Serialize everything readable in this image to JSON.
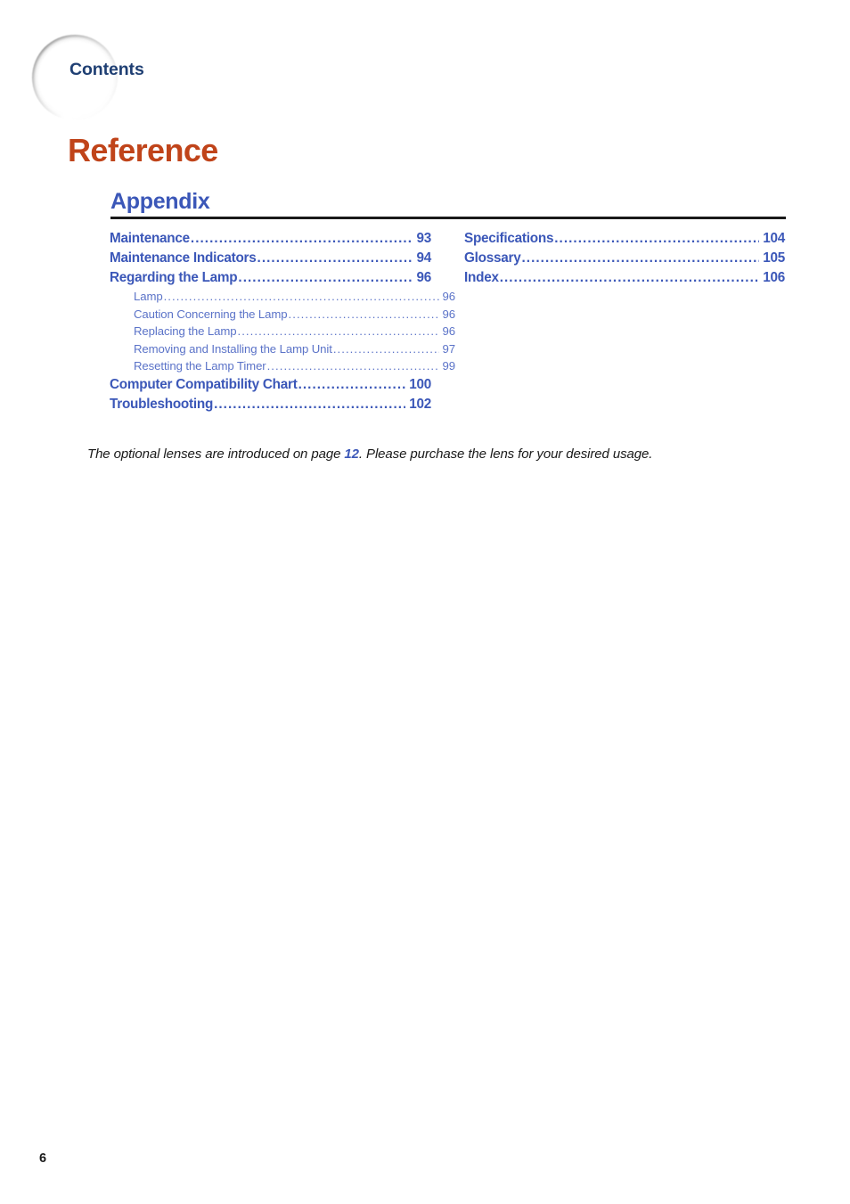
{
  "page": {
    "running_head": "Contents",
    "section_title": "Reference",
    "chapter_title": "Appendix",
    "folio": "6"
  },
  "toc": {
    "left_column": [
      {
        "level": "main",
        "label": "Maintenance",
        "page": "93"
      },
      {
        "level": "main",
        "label": "Maintenance Indicators",
        "page": "94"
      },
      {
        "level": "main",
        "label": "Regarding the Lamp",
        "page": "96"
      },
      {
        "level": "sub",
        "label": "Lamp",
        "page": "96"
      },
      {
        "level": "sub",
        "label": "Caution Concerning the Lamp",
        "page": "96"
      },
      {
        "level": "sub",
        "label": "Replacing the Lamp",
        "page": "96"
      },
      {
        "level": "sub",
        "label": "Removing and Installing the Lamp Unit",
        "page": "97"
      },
      {
        "level": "sub",
        "label": "Resetting the Lamp Timer",
        "page": "99"
      },
      {
        "level": "main",
        "label": "Computer Compatibility Chart",
        "page": "100"
      },
      {
        "level": "main",
        "label": "Troubleshooting",
        "page": "102"
      }
    ],
    "right_column": [
      {
        "level": "main",
        "label": "Specifications",
        "page": "104"
      },
      {
        "level": "main",
        "label": "Glossary",
        "page": "105"
      },
      {
        "level": "main",
        "label": "Index",
        "page": "106"
      }
    ]
  },
  "note": {
    "text_before": "The optional lenses are introduced on page ",
    "page_reference": "12",
    "text_after": ". Please purchase the lens for your desired usage."
  },
  "colors": {
    "section_title": "#C0441A",
    "chapter_title": "#3B57B8",
    "running_head": "#1F3F73",
    "toc_main": "#3B57B8",
    "toc_sub": "#5B73C8",
    "rule": "#1A1A1A",
    "body_text": "#1A1A1A"
  }
}
